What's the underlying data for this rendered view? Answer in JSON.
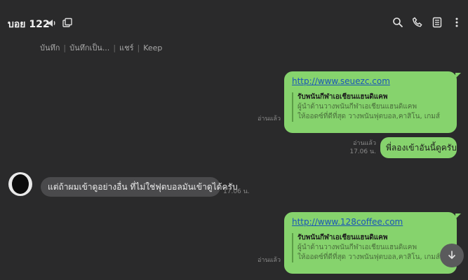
{
  "header": {
    "title": "บอย 122",
    "actions": [
      "บันทึก",
      "บันทึกเป็น...",
      "แชร์",
      "Keep"
    ]
  },
  "icons": {
    "mute": "speaker-icon",
    "external": "external-window-icon",
    "search": "search-icon",
    "call": "phone-icon",
    "notes": "notes-icon",
    "more": "more-vertical-icon",
    "scroll": "arrow-down-icon"
  },
  "messages": {
    "link1": {
      "url": "http://www.seuezc.com",
      "preview_title": "รับพนันกีฬาเอเชียนแฮนดิแคพ",
      "preview_line1": "ผู้นำด้านวางพนันกีฬาเอเชียนแฮนดิแคพ",
      "preview_line2": "ให้ออดซ์ที่ดีที่สุด วางพนันฟุตบอล,คาสิโน, เกมส์",
      "status": "อ่านแล้ว"
    },
    "text1": {
      "text": "พี่ลองเข้าอันนี้ดูครับ",
      "status": "อ่านแล้ว",
      "time": "17.06 น."
    },
    "incoming1": {
      "text": "แต่ถ้าผมเข้าดูอย่างอื่น ที่ไม่ใช่ฟุตบอลมันเข้าดูได้ครับ",
      "time": "17.06 น."
    },
    "link2": {
      "url": "http://www.128coffee.com",
      "preview_title": "รับพนันกีฬาเอเชียนแฮนดิแคพ",
      "preview_line1": "ผู้นำด้านวางพนันกีฬาเอเชียนแฮนดิแคพ",
      "preview_line2": "ให้ออดซ์ที่ดีที่สุด วางพนันฟุตบอล,คาสิโน, เกมส์",
      "status": "อ่านแล้ว"
    }
  },
  "colors": {
    "background": "#2a2a2b",
    "outgoing_bubble": "#86d36d",
    "incoming_bubble": "#4a4a4c",
    "link": "#1a55b8"
  }
}
